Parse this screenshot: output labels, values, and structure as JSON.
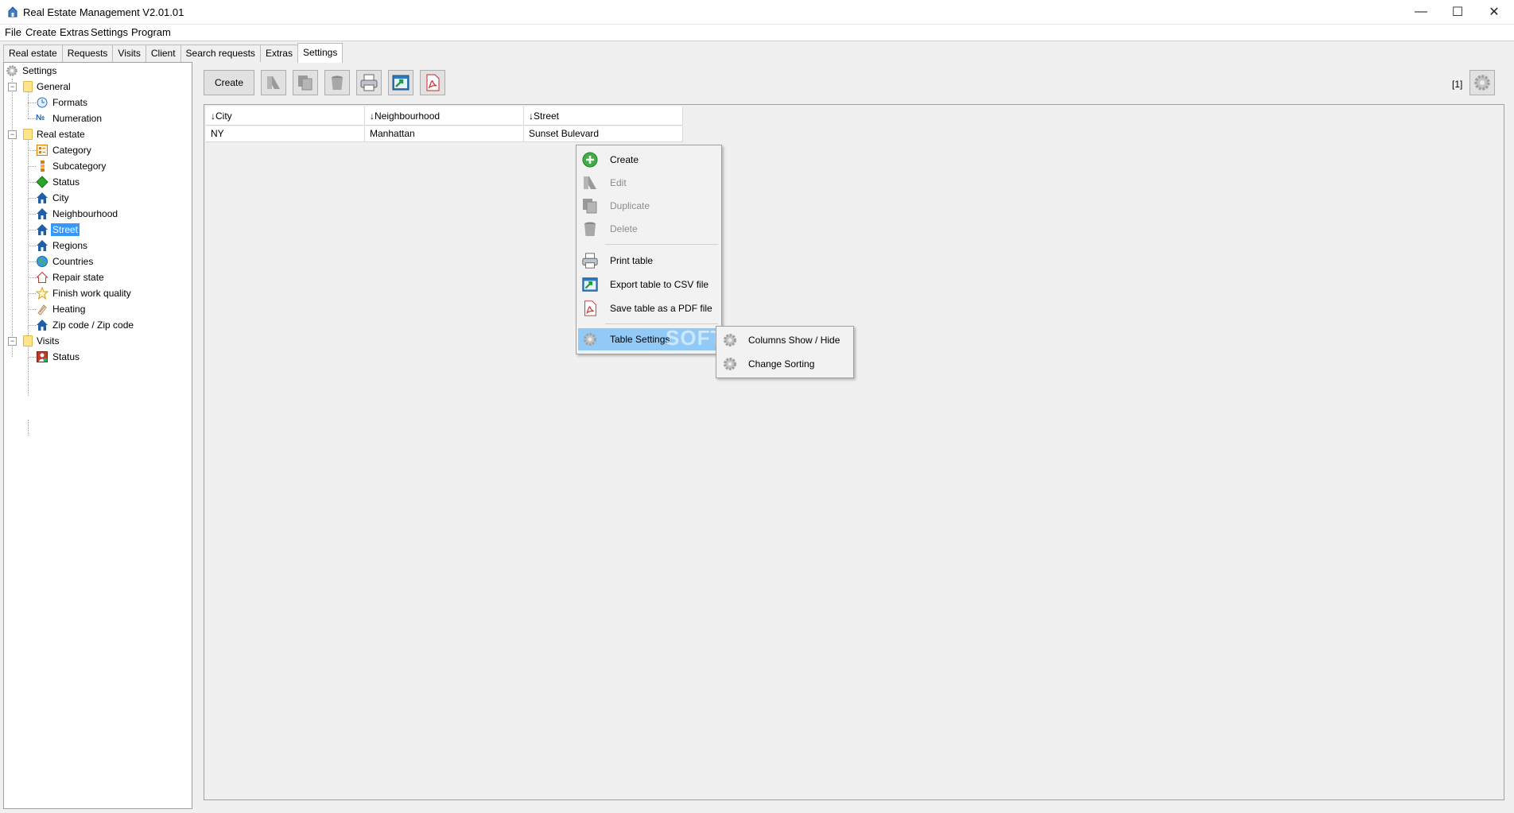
{
  "window": {
    "title": "Real Estate Management V2.01.01",
    "controls": {
      "minimize": "—",
      "maximize": "☐",
      "close": "✕"
    }
  },
  "menu": [
    "File",
    "Create",
    "Extras",
    "Settings",
    "Program"
  ],
  "tabs": [
    "Real estate",
    "Requests",
    "Visits",
    "Client",
    "Search requests",
    "Extras",
    "Settings"
  ],
  "active_tab": "Settings",
  "tree": {
    "root": "Settings",
    "groups": [
      {
        "label": "General",
        "items": [
          {
            "label": "Formats",
            "icon": "formats-icon"
          },
          {
            "label": "Numeration",
            "icon": "numeration-icon"
          }
        ]
      },
      {
        "label": "Real estate",
        "items": [
          {
            "label": "Category",
            "icon": "category-icon"
          },
          {
            "label": "Subcategory",
            "icon": "subcategory-icon"
          },
          {
            "label": "Status",
            "icon": "status-icon"
          },
          {
            "label": "City",
            "icon": "house-icon"
          },
          {
            "label": "Neighbourhood",
            "icon": "house-icon"
          },
          {
            "label": "Street",
            "icon": "house-icon",
            "selected": true
          },
          {
            "label": "Regions",
            "icon": "house-icon"
          },
          {
            "label": "Countries",
            "icon": "globe-icon"
          },
          {
            "label": "Repair state",
            "icon": "house-outline-icon"
          },
          {
            "label": "Finish work quality",
            "icon": "star-icon"
          },
          {
            "label": "Heating",
            "icon": "heating-icon"
          },
          {
            "label": "Zip code / Zip code",
            "icon": "house-icon"
          }
        ]
      },
      {
        "label": "Visits",
        "items": [
          {
            "label": "Status",
            "icon": "visit-status-icon"
          }
        ]
      }
    ]
  },
  "toolbar": {
    "create_label": "Create",
    "count": "[1]"
  },
  "table": {
    "columns": [
      "↓City",
      "↓Neighbourhood",
      "↓Street"
    ],
    "rows": [
      [
        "NY",
        "Manhattan",
        "Sunset Bulevard"
      ]
    ]
  },
  "context_menu": {
    "items": [
      {
        "label": "Create",
        "enabled": true
      },
      {
        "label": "Edit",
        "enabled": false
      },
      {
        "label": "Duplicate",
        "enabled": false
      },
      {
        "label": "Delete",
        "enabled": false
      },
      {
        "label": "Print table",
        "enabled": true
      },
      {
        "label": "Export table to CSV file",
        "enabled": true
      },
      {
        "label": "Save table as a PDF file",
        "enabled": true
      },
      {
        "label": "Table Settings",
        "enabled": true,
        "highlighted": true
      }
    ],
    "submenu": [
      "Columns Show / Hide",
      "Change Sorting"
    ]
  },
  "watermark": "SOFT",
  "colors": {
    "selection": "#3399ff",
    "menu_highlight": "#91c9f7",
    "folder": "#ffe58a",
    "house_blue": "#1f5fa8"
  }
}
